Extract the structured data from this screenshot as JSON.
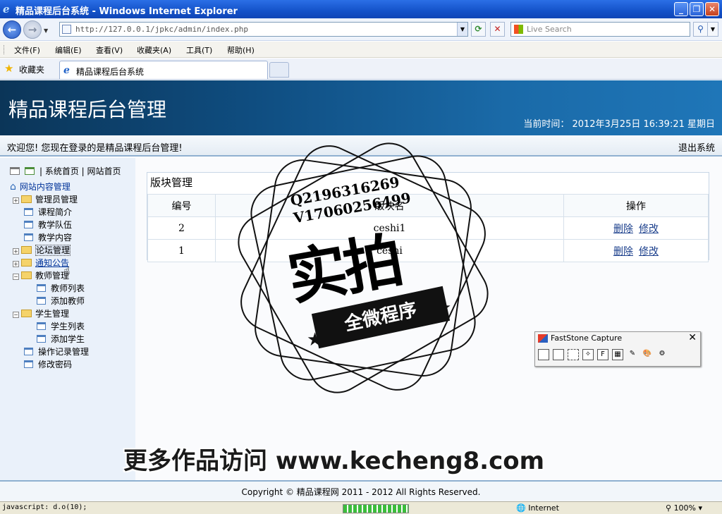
{
  "window": {
    "title": "精品课程后台系统 - Windows Internet Explorer"
  },
  "address_bar": {
    "url": "http://127.0.0.1/jpkc/admin/index.php",
    "search_placeholder": "Live Search"
  },
  "menu": [
    "文件(F)",
    "编辑(E)",
    "查看(V)",
    "收藏夹(A)",
    "工具(T)",
    "帮助(H)"
  ],
  "favorites": {
    "label": "收藏夹",
    "tab_title": "精品课程后台系统"
  },
  "header": {
    "title": "精品课程后台管理",
    "time": "当前时间： 2012年3月25日 16:39:21 星期日"
  },
  "welcome": {
    "text": "欢迎您! 您现在登录的是精品课程后台管理!",
    "logout": "退出系统"
  },
  "sidebar": {
    "top_links": "| 系统首页 | 网站首页",
    "root": "网站内容管理",
    "items": [
      "管理员管理",
      "课程简介",
      "教学队伍",
      "教学内容",
      "论坛管理",
      "通知公告",
      "教师管理",
      "教师列表",
      "添加教师",
      "学生管理",
      "学生列表",
      "添加学生",
      "操作记录管理",
      "修改密码"
    ]
  },
  "main": {
    "panel_title": "版块管理",
    "columns": [
      "编号",
      "版块名",
      "操作"
    ],
    "rows": [
      {
        "id": "2",
        "name": "ceshi1"
      },
      {
        "id": "1",
        "name": "ceshi"
      }
    ],
    "delete_label": "删除",
    "edit_label": "修改"
  },
  "footer": {
    "copyright": "Copyright © 精品课程网 2011 - 2012 All Rights Reserved."
  },
  "status": {
    "text": "javascript: d.o(10);",
    "zone": "Internet",
    "zoom": "100%"
  },
  "watermark": {
    "contact1": "Q2196316269",
    "contact2": "V17060256499",
    "big": "实拍",
    "banner": "全微程序",
    "promo": "更多作品访问 www.kecheng8.com"
  },
  "faststone": {
    "title": "FastStone Capture"
  }
}
